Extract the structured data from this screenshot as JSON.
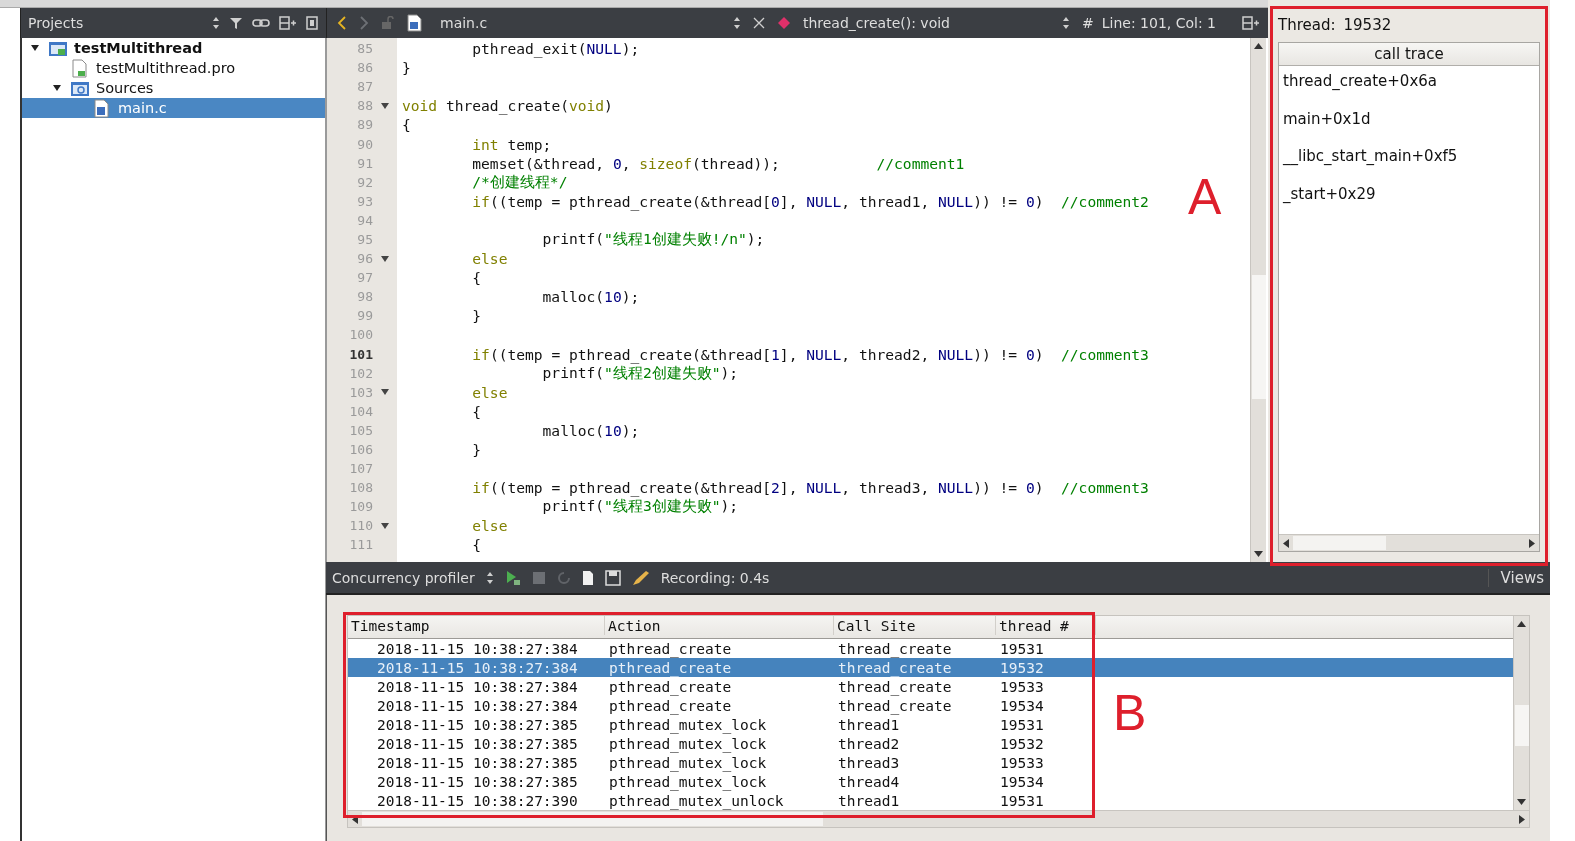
{
  "projects_panel": {
    "title": "Projects",
    "tree": [
      {
        "label": "testMultithread",
        "kind": "project",
        "expanded": true,
        "selected": false,
        "children": [
          {
            "label": "testMultithread.pro",
            "kind": "profile",
            "selected": false
          },
          {
            "label": "Sources",
            "kind": "folder",
            "expanded": true,
            "selected": false,
            "children": [
              {
                "label": "main.c",
                "kind": "source",
                "selected": true
              }
            ]
          }
        ]
      }
    ]
  },
  "editor": {
    "file": "main.c",
    "symbol": "thread_create(): void",
    "hash": "#",
    "position": "Line: 101, Col: 1",
    "lines": [
      {
        "num": "85",
        "code": [
          {
            "kind": "plain",
            "t": "        pthread_exit("
          },
          {
            "kind": "constant",
            "t": "NULL"
          },
          {
            "kind": "plain",
            "t": ");"
          }
        ]
      },
      {
        "num": "86",
        "code": [
          {
            "kind": "plain",
            "t": "}"
          }
        ]
      },
      {
        "num": "87"
      },
      {
        "num": "88",
        "fold": true,
        "code": [
          {
            "kind": "keyword",
            "t": "void"
          },
          {
            "kind": "plain",
            "t": " thread_create("
          },
          {
            "kind": "keyword",
            "t": "void"
          },
          {
            "kind": "plain",
            "t": ")"
          }
        ]
      },
      {
        "num": "89",
        "code": [
          {
            "kind": "plain",
            "t": "{"
          }
        ]
      },
      {
        "num": "90",
        "code": [
          {
            "kind": "keyword",
            "t": "        int"
          },
          {
            "kind": "plain",
            "t": " temp;"
          }
        ]
      },
      {
        "num": "91",
        "code": [
          {
            "kind": "plain",
            "t": "        memset(&thread, "
          },
          {
            "kind": "constant",
            "t": "0"
          },
          {
            "kind": "plain",
            "t": ", "
          },
          {
            "kind": "keyword",
            "t": "sizeof"
          },
          {
            "kind": "plain",
            "t": "(thread));           "
          },
          {
            "kind": "comment",
            "t": "//comment1"
          }
        ]
      },
      {
        "num": "92",
        "code": [
          {
            "kind": "comment",
            "t": "        /*创建线程*/"
          }
        ]
      },
      {
        "num": "93",
        "code": [
          {
            "kind": "keyword",
            "t": "        if"
          },
          {
            "kind": "plain",
            "t": "((temp = pthread_create(&thread["
          },
          {
            "kind": "constant",
            "t": "0"
          },
          {
            "kind": "plain",
            "t": "], "
          },
          {
            "kind": "constant",
            "t": "NULL"
          },
          {
            "kind": "plain",
            "t": ", thread1, "
          },
          {
            "kind": "constant",
            "t": "NULL"
          },
          {
            "kind": "plain",
            "t": ")) != "
          },
          {
            "kind": "constant",
            "t": "0"
          },
          {
            "kind": "plain",
            "t": ")  "
          },
          {
            "kind": "comment",
            "t": "//comment2"
          }
        ]
      },
      {
        "num": "94"
      },
      {
        "num": "95",
        "code": [
          {
            "kind": "plain",
            "t": "                printf("
          },
          {
            "kind": "string",
            "t": "\"线程1创建失败!/n\""
          },
          {
            "kind": "plain",
            "t": ");"
          }
        ]
      },
      {
        "num": "96",
        "fold": true,
        "code": [
          {
            "kind": "keyword",
            "t": "        else"
          }
        ]
      },
      {
        "num": "97",
        "code": [
          {
            "kind": "plain",
            "t": "        {"
          }
        ]
      },
      {
        "num": "98",
        "code": [
          {
            "kind": "plain",
            "t": "                malloc("
          },
          {
            "kind": "constant",
            "t": "10"
          },
          {
            "kind": "plain",
            "t": ");"
          }
        ]
      },
      {
        "num": "99",
        "code": [
          {
            "kind": "plain",
            "t": "        }"
          }
        ]
      },
      {
        "num": "100"
      },
      {
        "num": "101",
        "current": true,
        "code": [
          {
            "kind": "keyword",
            "t": "        if"
          },
          {
            "kind": "plain",
            "t": "((temp = pthread_create(&thread["
          },
          {
            "kind": "constant",
            "t": "1"
          },
          {
            "kind": "plain",
            "t": "], "
          },
          {
            "kind": "constant",
            "t": "NULL"
          },
          {
            "kind": "plain",
            "t": ", thread2, "
          },
          {
            "kind": "constant",
            "t": "NULL"
          },
          {
            "kind": "plain",
            "t": ")) != "
          },
          {
            "kind": "constant",
            "t": "0"
          },
          {
            "kind": "plain",
            "t": ")  "
          },
          {
            "kind": "comment",
            "t": "//comment3"
          }
        ]
      },
      {
        "num": "102",
        "code": [
          {
            "kind": "plain",
            "t": "                printf("
          },
          {
            "kind": "string",
            "t": "\"线程2创建失败\""
          },
          {
            "kind": "plain",
            "t": ");"
          }
        ]
      },
      {
        "num": "103",
        "fold": true,
        "code": [
          {
            "kind": "keyword",
            "t": "        else"
          }
        ]
      },
      {
        "num": "104",
        "code": [
          {
            "kind": "plain",
            "t": "        {"
          }
        ]
      },
      {
        "num": "105",
        "code": [
          {
            "kind": "plain",
            "t": "                malloc("
          },
          {
            "kind": "constant",
            "t": "10"
          },
          {
            "kind": "plain",
            "t": ");"
          }
        ]
      },
      {
        "num": "106",
        "code": [
          {
            "kind": "plain",
            "t": "        }"
          }
        ]
      },
      {
        "num": "107"
      },
      {
        "num": "108",
        "code": [
          {
            "kind": "keyword",
            "t": "        if"
          },
          {
            "kind": "plain",
            "t": "((temp = pthread_create(&thread["
          },
          {
            "kind": "constant",
            "t": "2"
          },
          {
            "kind": "plain",
            "t": "], "
          },
          {
            "kind": "constant",
            "t": "NULL"
          },
          {
            "kind": "plain",
            "t": ", thread3, "
          },
          {
            "kind": "constant",
            "t": "NULL"
          },
          {
            "kind": "plain",
            "t": ")) != "
          },
          {
            "kind": "constant",
            "t": "0"
          },
          {
            "kind": "plain",
            "t": ")  "
          },
          {
            "kind": "comment",
            "t": "//comment3"
          }
        ]
      },
      {
        "num": "109",
        "code": [
          {
            "kind": "plain",
            "t": "                printf("
          },
          {
            "kind": "string",
            "t": "\"线程3创建失败\""
          },
          {
            "kind": "plain",
            "t": ");"
          }
        ]
      },
      {
        "num": "110",
        "fold": true,
        "code": [
          {
            "kind": "keyword",
            "t": "        else"
          }
        ]
      },
      {
        "num": "111",
        "code": [
          {
            "kind": "plain",
            "t": "        {"
          }
        ]
      }
    ]
  },
  "thread_panel": {
    "label": "Thread:",
    "value": "19532",
    "header": "call trace",
    "frames": [
      "thread_create+0x6a",
      "main+0x1d",
      "__libc_start_main+0xf5",
      "_start+0x29"
    ]
  },
  "profiler": {
    "title": "Concurrency profiler",
    "recording": "Recording: 0.4s",
    "views": "Views",
    "columns": [
      "Timestamp",
      "Action",
      "Call Site",
      "thread #"
    ],
    "rows": [
      {
        "cells": [
          "2018-11-15 10:38:27:384",
          "pthread_create",
          "thread_create",
          "19531"
        ],
        "selected": false
      },
      {
        "cells": [
          "2018-11-15 10:38:27:384",
          "pthread_create",
          "thread_create",
          "19532"
        ],
        "selected": true
      },
      {
        "cells": [
          "2018-11-15 10:38:27:384",
          "pthread_create",
          "thread_create",
          "19533"
        ],
        "selected": false
      },
      {
        "cells": [
          "2018-11-15 10:38:27:384",
          "pthread_create",
          "thread_create",
          "19534"
        ],
        "selected": false
      },
      {
        "cells": [
          "2018-11-15 10:38:27:385",
          "pthread_mutex_lock",
          "thread1",
          "19531"
        ],
        "selected": false
      },
      {
        "cells": [
          "2018-11-15 10:38:27:385",
          "pthread_mutex_lock",
          "thread2",
          "19532"
        ],
        "selected": false
      },
      {
        "cells": [
          "2018-11-15 10:38:27:385",
          "pthread_mutex_lock",
          "thread3",
          "19533"
        ],
        "selected": false
      },
      {
        "cells": [
          "2018-11-15 10:38:27:385",
          "pthread_mutex_lock",
          "thread4",
          "19534"
        ],
        "selected": false
      },
      {
        "cells": [
          "2018-11-15 10:38:27:390",
          "pthread_mutex_unlock",
          "thread1",
          "19531"
        ],
        "selected": false
      }
    ]
  },
  "annotations": [
    {
      "label": "A"
    },
    {
      "label": "B"
    }
  ]
}
